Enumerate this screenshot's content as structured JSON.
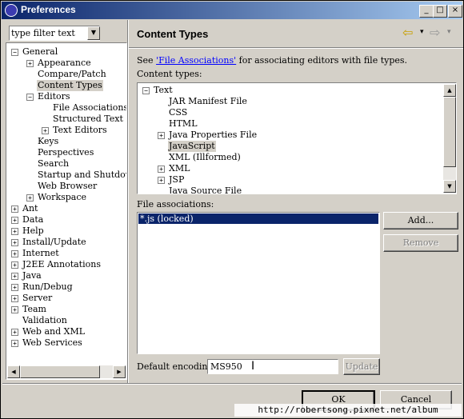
{
  "window": {
    "title": "Preferences",
    "controls": {
      "minimize": "_",
      "maximize": "□",
      "close": "×"
    }
  },
  "filter": {
    "value": "type filter text"
  },
  "tree": [
    {
      "label": "General",
      "level": 0,
      "expander": "−"
    },
    {
      "label": "Appearance",
      "level": 1,
      "expander": "+"
    },
    {
      "label": "Compare/Patch",
      "level": 1,
      "expander": ""
    },
    {
      "label": "Content Types",
      "level": 1,
      "expander": "",
      "selected": true
    },
    {
      "label": "Editors",
      "level": 1,
      "expander": "−"
    },
    {
      "label": "File Associations",
      "level": 2,
      "expander": ""
    },
    {
      "label": "Structured Text Ed",
      "level": 2,
      "expander": ""
    },
    {
      "label": "Text Editors",
      "level": 2,
      "expander": "+"
    },
    {
      "label": "Keys",
      "level": 1,
      "expander": ""
    },
    {
      "label": "Perspectives",
      "level": 1,
      "expander": ""
    },
    {
      "label": "Search",
      "level": 1,
      "expander": ""
    },
    {
      "label": "Startup and Shutdown",
      "level": 1,
      "expander": ""
    },
    {
      "label": "Web Browser",
      "level": 1,
      "expander": ""
    },
    {
      "label": "Workspace",
      "level": 1,
      "expander": "+"
    },
    {
      "label": "Ant",
      "level": 0,
      "expander": "+"
    },
    {
      "label": "Data",
      "level": 0,
      "expander": "+"
    },
    {
      "label": "Help",
      "level": 0,
      "expander": "+"
    },
    {
      "label": "Install/Update",
      "level": 0,
      "expander": "+"
    },
    {
      "label": "Internet",
      "level": 0,
      "expander": "+"
    },
    {
      "label": "J2EE Annotations",
      "level": 0,
      "expander": "+"
    },
    {
      "label": "Java",
      "level": 0,
      "expander": "+"
    },
    {
      "label": "Run/Debug",
      "level": 0,
      "expander": "+"
    },
    {
      "label": "Server",
      "level": 0,
      "expander": "+"
    },
    {
      "label": "Team",
      "level": 0,
      "expander": "+"
    },
    {
      "label": "Validation",
      "level": 0,
      "expander": ""
    },
    {
      "label": "Web and XML",
      "level": 0,
      "expander": "+"
    },
    {
      "label": "Web Services",
      "level": 0,
      "expander": "+"
    }
  ],
  "page": {
    "title": "Content Types",
    "nav": {
      "back": "⇦",
      "forward": "⇨",
      "menu": "▾"
    },
    "see_prefix": "See ",
    "see_link": "'File Associations'",
    "see_suffix": " for associating editors with file types.",
    "content_types_label": "Content types:",
    "content_types": [
      {
        "label": "Text",
        "level": 0,
        "expander": "−"
      },
      {
        "label": "JAR Manifest File",
        "level": 1,
        "expander": ""
      },
      {
        "label": "CSS",
        "level": 1,
        "expander": ""
      },
      {
        "label": "HTML",
        "level": 1,
        "expander": ""
      },
      {
        "label": "Java Properties File",
        "level": 1,
        "expander": "+"
      },
      {
        "label": "JavaScript",
        "level": 1,
        "expander": "",
        "selected": true
      },
      {
        "label": "XML (Illformed)",
        "level": 1,
        "expander": ""
      },
      {
        "label": "XML",
        "level": 1,
        "expander": "+"
      },
      {
        "label": "JSP",
        "level": 1,
        "expander": "+"
      },
      {
        "label": "Java Source File",
        "level": 1,
        "expander": ""
      }
    ],
    "file_assoc_label": "File associations:",
    "file_assoc": [
      "*.js (locked)"
    ],
    "add_button": "Add...",
    "remove_button": "Remove",
    "encoding_label": "Default encoding:",
    "encoding_value": "MS950",
    "update_button": "Update"
  },
  "footer": {
    "ok_button": "OK",
    "cancel_button": "Cancel",
    "watermark": "http://robertsong.pixnet.net/album"
  },
  "colors": {
    "selection": "#0a246a",
    "link": "#0000ff",
    "titlebar_start": "#0a246a",
    "titlebar_end": "#a6caf0"
  }
}
